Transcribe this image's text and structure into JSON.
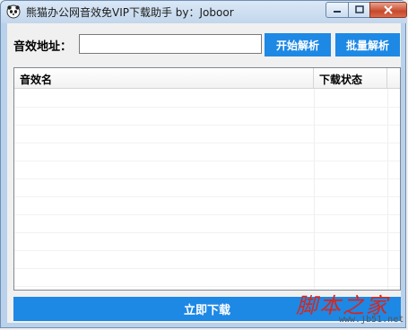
{
  "window": {
    "title": "熊猫办公网音效免VIP下载助手    by：Joboor"
  },
  "form": {
    "label": "音效地址：",
    "url_value": "",
    "parse_button": "开始解析",
    "batch_button": "批量解析"
  },
  "list": {
    "columns": [
      "音效名",
      "下载状态"
    ],
    "rows": []
  },
  "download_button": "立即下载",
  "watermark": {
    "text": "脚本之家",
    "url": "www.jb51.net"
  },
  "colors": {
    "accent": "#1e88e5",
    "watermark": "#d8261c"
  },
  "icons": {
    "app": "panda-icon",
    "minimize": "minimize-icon",
    "maximize": "maximize-icon",
    "close": "close-icon"
  }
}
